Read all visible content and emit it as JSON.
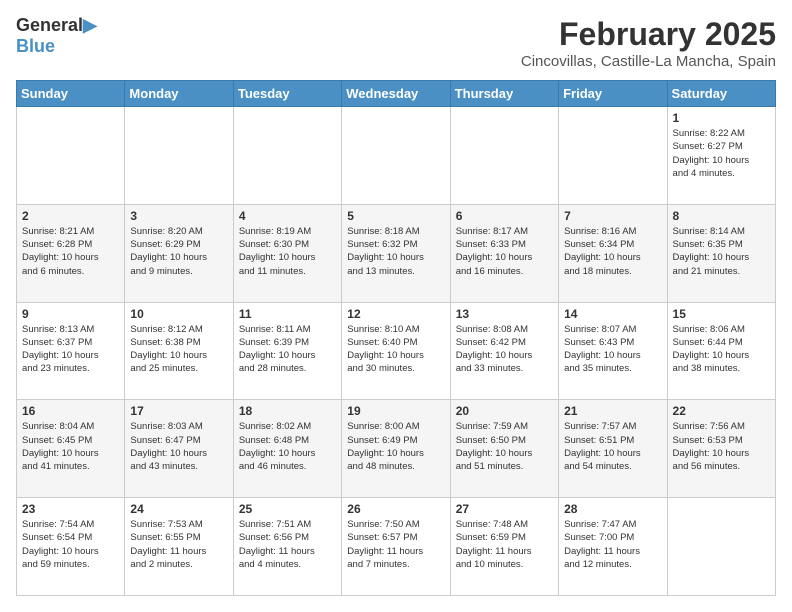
{
  "header": {
    "logo_line1": "General",
    "logo_line2": "Blue",
    "month": "February 2025",
    "location": "Cincovillas, Castille-La Mancha, Spain"
  },
  "weekdays": [
    "Sunday",
    "Monday",
    "Tuesday",
    "Wednesday",
    "Thursday",
    "Friday",
    "Saturday"
  ],
  "weeks": [
    [
      {
        "day": "",
        "info": ""
      },
      {
        "day": "",
        "info": ""
      },
      {
        "day": "",
        "info": ""
      },
      {
        "day": "",
        "info": ""
      },
      {
        "day": "",
        "info": ""
      },
      {
        "day": "",
        "info": ""
      },
      {
        "day": "1",
        "info": "Sunrise: 8:22 AM\nSunset: 6:27 PM\nDaylight: 10 hours\nand 4 minutes."
      }
    ],
    [
      {
        "day": "2",
        "info": "Sunrise: 8:21 AM\nSunset: 6:28 PM\nDaylight: 10 hours\nand 6 minutes."
      },
      {
        "day": "3",
        "info": "Sunrise: 8:20 AM\nSunset: 6:29 PM\nDaylight: 10 hours\nand 9 minutes."
      },
      {
        "day": "4",
        "info": "Sunrise: 8:19 AM\nSunset: 6:30 PM\nDaylight: 10 hours\nand 11 minutes."
      },
      {
        "day": "5",
        "info": "Sunrise: 8:18 AM\nSunset: 6:32 PM\nDaylight: 10 hours\nand 13 minutes."
      },
      {
        "day": "6",
        "info": "Sunrise: 8:17 AM\nSunset: 6:33 PM\nDaylight: 10 hours\nand 16 minutes."
      },
      {
        "day": "7",
        "info": "Sunrise: 8:16 AM\nSunset: 6:34 PM\nDaylight: 10 hours\nand 18 minutes."
      },
      {
        "day": "8",
        "info": "Sunrise: 8:14 AM\nSunset: 6:35 PM\nDaylight: 10 hours\nand 21 minutes."
      }
    ],
    [
      {
        "day": "9",
        "info": "Sunrise: 8:13 AM\nSunset: 6:37 PM\nDaylight: 10 hours\nand 23 minutes."
      },
      {
        "day": "10",
        "info": "Sunrise: 8:12 AM\nSunset: 6:38 PM\nDaylight: 10 hours\nand 25 minutes."
      },
      {
        "day": "11",
        "info": "Sunrise: 8:11 AM\nSunset: 6:39 PM\nDaylight: 10 hours\nand 28 minutes."
      },
      {
        "day": "12",
        "info": "Sunrise: 8:10 AM\nSunset: 6:40 PM\nDaylight: 10 hours\nand 30 minutes."
      },
      {
        "day": "13",
        "info": "Sunrise: 8:08 AM\nSunset: 6:42 PM\nDaylight: 10 hours\nand 33 minutes."
      },
      {
        "day": "14",
        "info": "Sunrise: 8:07 AM\nSunset: 6:43 PM\nDaylight: 10 hours\nand 35 minutes."
      },
      {
        "day": "15",
        "info": "Sunrise: 8:06 AM\nSunset: 6:44 PM\nDaylight: 10 hours\nand 38 minutes."
      }
    ],
    [
      {
        "day": "16",
        "info": "Sunrise: 8:04 AM\nSunset: 6:45 PM\nDaylight: 10 hours\nand 41 minutes."
      },
      {
        "day": "17",
        "info": "Sunrise: 8:03 AM\nSunset: 6:47 PM\nDaylight: 10 hours\nand 43 minutes."
      },
      {
        "day": "18",
        "info": "Sunrise: 8:02 AM\nSunset: 6:48 PM\nDaylight: 10 hours\nand 46 minutes."
      },
      {
        "day": "19",
        "info": "Sunrise: 8:00 AM\nSunset: 6:49 PM\nDaylight: 10 hours\nand 48 minutes."
      },
      {
        "day": "20",
        "info": "Sunrise: 7:59 AM\nSunset: 6:50 PM\nDaylight: 10 hours\nand 51 minutes."
      },
      {
        "day": "21",
        "info": "Sunrise: 7:57 AM\nSunset: 6:51 PM\nDaylight: 10 hours\nand 54 minutes."
      },
      {
        "day": "22",
        "info": "Sunrise: 7:56 AM\nSunset: 6:53 PM\nDaylight: 10 hours\nand 56 minutes."
      }
    ],
    [
      {
        "day": "23",
        "info": "Sunrise: 7:54 AM\nSunset: 6:54 PM\nDaylight: 10 hours\nand 59 minutes."
      },
      {
        "day": "24",
        "info": "Sunrise: 7:53 AM\nSunset: 6:55 PM\nDaylight: 11 hours\nand 2 minutes."
      },
      {
        "day": "25",
        "info": "Sunrise: 7:51 AM\nSunset: 6:56 PM\nDaylight: 11 hours\nand 4 minutes."
      },
      {
        "day": "26",
        "info": "Sunrise: 7:50 AM\nSunset: 6:57 PM\nDaylight: 11 hours\nand 7 minutes."
      },
      {
        "day": "27",
        "info": "Sunrise: 7:48 AM\nSunset: 6:59 PM\nDaylight: 11 hours\nand 10 minutes."
      },
      {
        "day": "28",
        "info": "Sunrise: 7:47 AM\nSunset: 7:00 PM\nDaylight: 11 hours\nand 12 minutes."
      },
      {
        "day": "",
        "info": ""
      }
    ]
  ]
}
